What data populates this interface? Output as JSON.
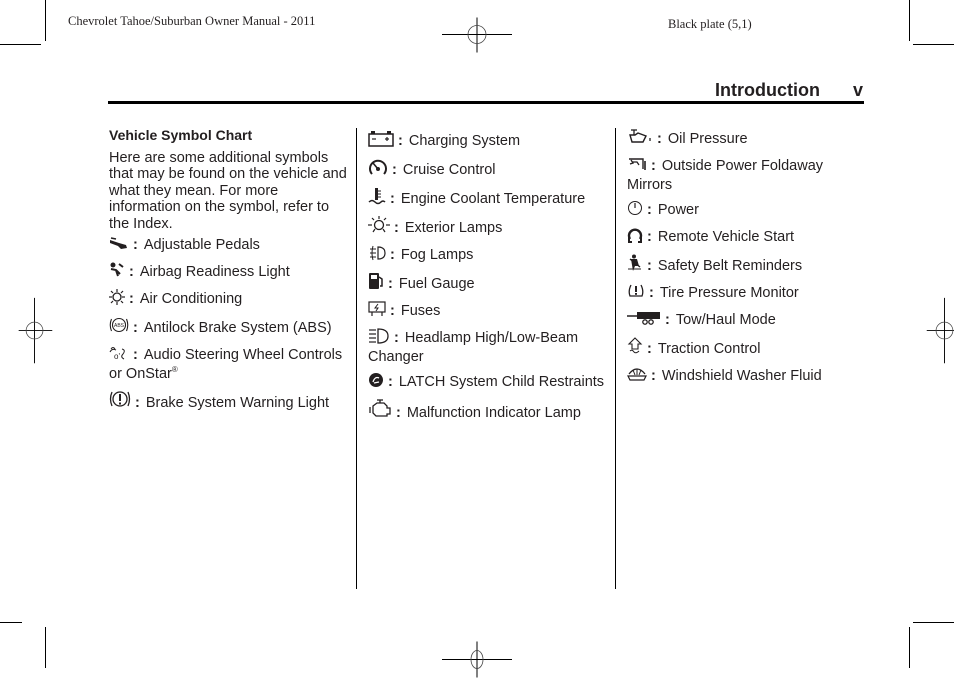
{
  "header": {
    "manual_title": "Chevrolet Tahoe/Suburban Owner Manual - 2011",
    "plate": "Black plate (5,1)",
    "section_title": "Introduction",
    "page_number": "v"
  },
  "intro": {
    "heading": "Vehicle Symbol Chart",
    "paragraph": "Here are some additional symbols that may be found on the vehicle and what they mean. For more information on the symbol, refer to the Index."
  },
  "columns": [
    [
      {
        "icon": "adjustable-pedals-icon",
        "label": "Adjustable Pedals"
      },
      {
        "icon": "airbag-readiness-icon",
        "label": "Airbag Readiness Light"
      },
      {
        "icon": "air-conditioning-icon",
        "label": "Air Conditioning"
      },
      {
        "icon": "abs-icon",
        "label": "Antilock Brake System (ABS)"
      },
      {
        "icon": "audio-steering-controls-icon",
        "label": "Audio Steering Wheel Controls or OnStar",
        "sup": "®"
      },
      {
        "icon": "brake-warning-icon",
        "label": "Brake System Warning Light"
      }
    ],
    [
      {
        "icon": "battery-icon",
        "label": "Charging System"
      },
      {
        "icon": "cruise-control-icon",
        "label": "Cruise Control"
      },
      {
        "icon": "coolant-temperature-icon",
        "label": "Engine Coolant Temperature"
      },
      {
        "icon": "exterior-lamps-icon",
        "label": "Exterior Lamps"
      },
      {
        "icon": "fog-lamps-icon",
        "label": "Fog Lamps"
      },
      {
        "icon": "fuel-gauge-icon",
        "label": "Fuel Gauge"
      },
      {
        "icon": "fuses-icon",
        "label": "Fuses"
      },
      {
        "icon": "headlamp-beam-icon",
        "label": "Headlamp High/Low-Beam Changer"
      },
      {
        "icon": "latch-child-restraint-icon",
        "label": "LATCH System Child Restraints"
      },
      {
        "icon": "check-engine-icon",
        "label": "Malfunction Indicator Lamp"
      }
    ],
    [
      {
        "icon": "oil-pressure-icon",
        "label": "Oil Pressure"
      },
      {
        "icon": "folding-mirror-icon",
        "label": "Outside Power Foldaway Mirrors"
      },
      {
        "icon": "power-icon",
        "label": "Power"
      },
      {
        "icon": "remote-start-icon",
        "label": "Remote Vehicle Start"
      },
      {
        "icon": "seatbelt-reminder-icon",
        "label": "Safety Belt Reminders"
      },
      {
        "icon": "tire-pressure-icon",
        "label": "Tire Pressure Monitor"
      },
      {
        "icon": "tow-haul-icon",
        "label": "Tow/Haul Mode"
      },
      {
        "icon": "traction-control-icon",
        "label": "Traction Control"
      },
      {
        "icon": "washer-fluid-icon",
        "label": "Windshield Washer Fluid"
      }
    ]
  ],
  "entry_separator": ":"
}
